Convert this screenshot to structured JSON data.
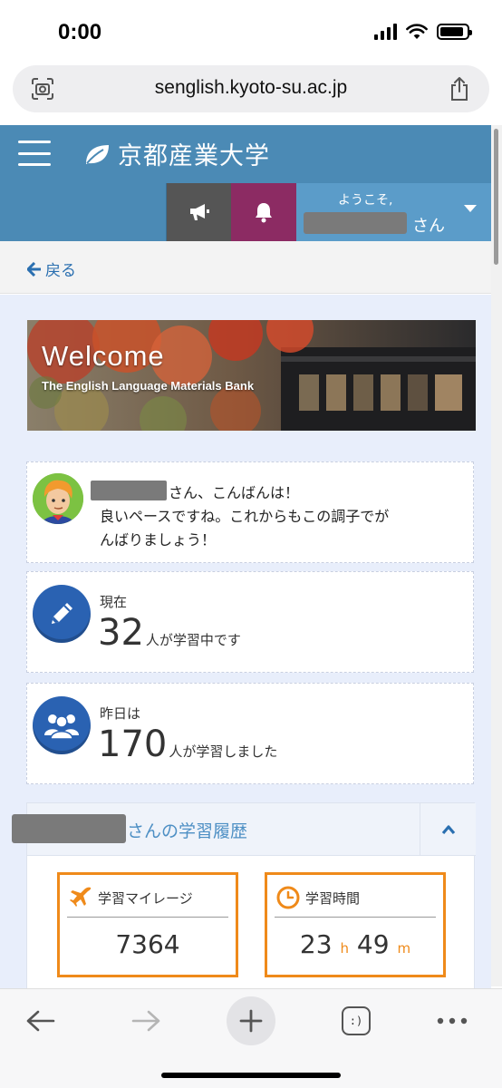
{
  "status_bar": {
    "time": "0:00"
  },
  "browser": {
    "url": "senglish.kyoto-su.ac.jp"
  },
  "site": {
    "logo_text": "京都産業大学",
    "user_welcome": "ようこそ,",
    "user_suffix": "さん",
    "back_label": "戻る"
  },
  "banner": {
    "title": "Welcome",
    "subtitle": "The English Language Materials Bank"
  },
  "greeting": {
    "line1": "さん、こんばんは！",
    "line2": "良いペースですね。これからもこの調子でが",
    "line3": "んばりましょう！"
  },
  "stats": {
    "now_label": "現在",
    "now_value": "32",
    "now_suffix": "人が学習中です",
    "yesterday_label": "昨日は",
    "yesterday_value": "170",
    "yesterday_suffix": "人が学習しました"
  },
  "history": {
    "title": "さんの学習履歴",
    "mileage_label": "学習マイレージ",
    "mileage_value": "7364",
    "time_label": "学習時間",
    "time_hours": "23",
    "time_hours_unit": "h",
    "time_minutes": "49",
    "time_minutes_unit": "m"
  },
  "toolbar": {
    "tabs_label": ":)"
  },
  "colors": {
    "header_blue": "#4b8ab5",
    "user_menu_blue": "#5b9cc9",
    "notify_magenta": "#8c2b63",
    "announce_gray": "#555555",
    "accent_orange": "#ef8a1a",
    "stat_icon_blue": "#2a62b2",
    "content_bg": "#e8eefb"
  },
  "icons": {
    "lens": "camera-lens-icon",
    "share": "share-icon",
    "menu": "hamburger-icon",
    "logo": "leaf-icon",
    "announce": "megaphone-icon",
    "notify": "bell-icon",
    "dropdown": "caret-down-icon",
    "back": "arrow-left-icon",
    "edit": "pencil-icon",
    "users": "group-icon",
    "collapse": "chevron-up-icon",
    "mileage": "airplane-icon",
    "time": "clock-icon",
    "nav_back": "arrow-left-icon",
    "nav_forward": "arrow-right-icon",
    "new_tab": "plus-icon",
    "tabs": "tabs-icon",
    "more": "more-icon"
  }
}
